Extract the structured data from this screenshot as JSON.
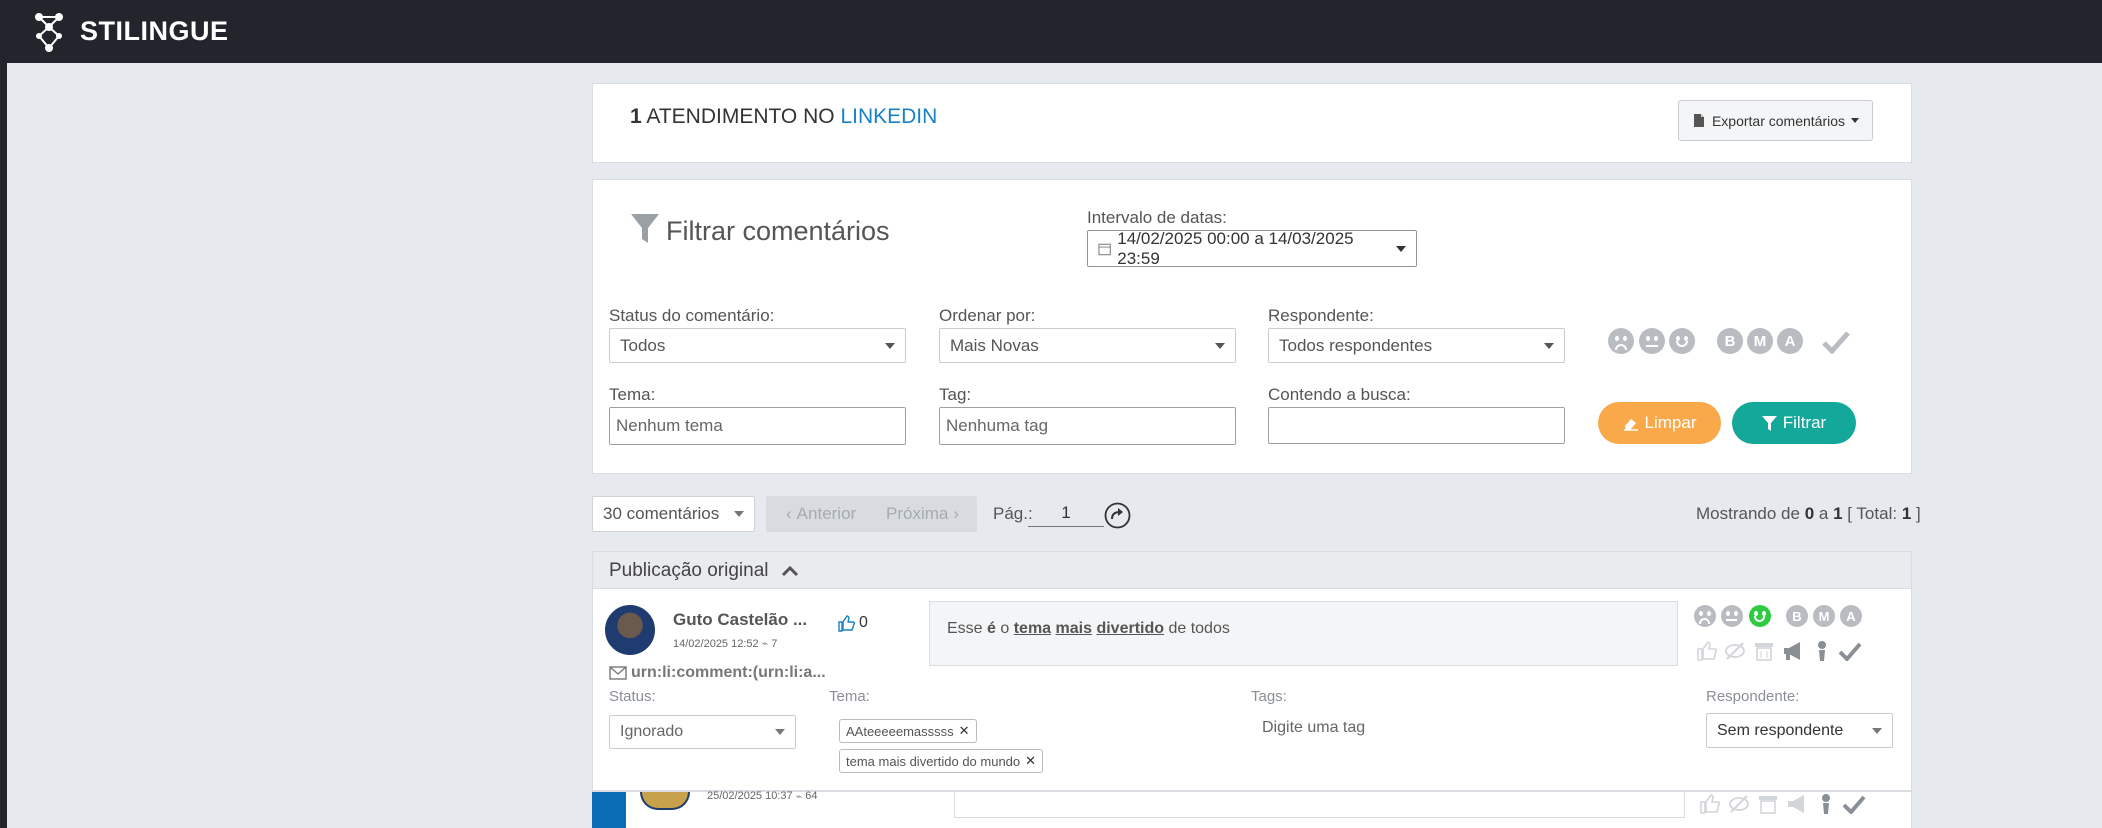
{
  "app": {
    "brand": "STILINGUE"
  },
  "header": {
    "count": "1",
    "title_middle": "ATENDIMENTO NO",
    "network": "LINKEDIN",
    "export_label": "Exportar comentários"
  },
  "filters": {
    "title": "Filtrar comentários",
    "date_label": "Intervalo de datas:",
    "date_value": "14/02/2025 00:00 a 14/03/2025 23:59",
    "status_label": "Status do comentário:",
    "status_value": "Todos",
    "order_label": "Ordenar por:",
    "order_value": "Mais Novas",
    "responder_label": "Respondente:",
    "responder_value": "Todos respondentes",
    "theme_label": "Tema:",
    "theme_placeholder": "Nenhum tema",
    "tag_label": "Tag:",
    "tag_placeholder": "Nenhuma tag",
    "search_label": "Contendo a busca:",
    "search_value": "",
    "clear_label": "Limpar",
    "filter_label": "Filtrar",
    "priority_letters": [
      "B",
      "M",
      "A"
    ]
  },
  "pagination": {
    "per_page": "30 comentários",
    "prev": "Anterior",
    "next": "Próxima",
    "page_label": "Pág.:",
    "page_value": "1",
    "showing_prefix": "Mostrando de",
    "from": "0",
    "to_word": "a",
    "to": "1",
    "total_prefix": "[ Total:",
    "total": "1",
    "total_suffix": "]"
  },
  "section": {
    "title": "Publicação original"
  },
  "comment": {
    "author": "Guto Castelão ...",
    "datetime": "14/02/2025 12:52",
    "reactions": "7",
    "likes": "0",
    "text_parts": [
      "Esse ",
      "é",
      " o ",
      "tema",
      " ",
      "mais",
      " ",
      "divertido",
      " de todos"
    ],
    "urn": "urn:li:comment:(urn:li:a...",
    "status_label": "Status:",
    "status_value": "Ignorado",
    "theme_label": "Tema:",
    "themes": [
      "AAteeeeemasssss",
      "tema mais divertido do mundo"
    ],
    "tags_label": "Tags:",
    "tags_placeholder": "Digite uma tag",
    "responder_label": "Respondente:",
    "responder_value": "Sem respondente",
    "priority_letters": [
      "B",
      "M",
      "A"
    ],
    "sentiment_colors": {
      "active": "#2ecc40",
      "inactive": "#b9bdc2"
    }
  },
  "next_comment": {
    "datetime": "25/02/2025 10:37",
    "reactions": "64"
  },
  "colors": {
    "topbar": "#23252c",
    "accent_link": "#1a82c4",
    "limpar": "#f9a94a",
    "filtrar": "#14a89b",
    "blue_bar": "#0b6eb5"
  }
}
